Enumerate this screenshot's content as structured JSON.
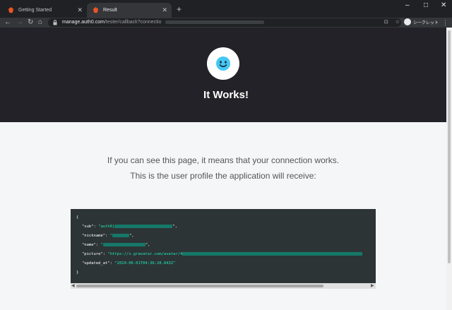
{
  "tabs": [
    {
      "label": "Getting Started",
      "active": false
    },
    {
      "label": "Result",
      "active": true
    }
  ],
  "address_bar": {
    "host": "manage.auth0.com",
    "path": "/tester/callback?connectio"
  },
  "profile": {
    "label": "シークレット"
  },
  "hero": {
    "title": "It Works!"
  },
  "message": {
    "line1": "If you can see this page, it means that your connection works.",
    "line2": "This is the user profile the application will receive:"
  },
  "profile_json": {
    "open": "{",
    "close": "}",
    "fields": [
      {
        "key": "\"sub\": ",
        "value_visible": "\"auth0|",
        "value_tail": "\","
      },
      {
        "key": "\"nickname\": ",
        "value_visible": "\"",
        "value_tail": "\","
      },
      {
        "key": "\"name\": ",
        "value_visible": "\"",
        "value_tail": "\","
      },
      {
        "key": "\"picture\": ",
        "value_visible": "\"https://s.gravatar.com/avatar/4",
        "value_tail": ""
      },
      {
        "key": "\"updated_at\": ",
        "value_visible": "\"2020-06-01T04:36:28.843Z\"",
        "value_tail": ""
      }
    ]
  },
  "colors": {
    "hero_bg": "#222228",
    "page_bg": "#f5f6f8",
    "code_bg": "#2d3436",
    "code_string": "#1de9b6",
    "smiley": "#44c7f4"
  },
  "icons": [
    "auth0-favicon",
    "close-icon",
    "plus-icon",
    "back-arrow-icon",
    "forward-arrow-icon",
    "reload-icon",
    "home-icon",
    "lock-icon",
    "translate-icon",
    "star-icon",
    "incognito-icon",
    "kebab-menu-icon",
    "smiley-icon"
  ]
}
